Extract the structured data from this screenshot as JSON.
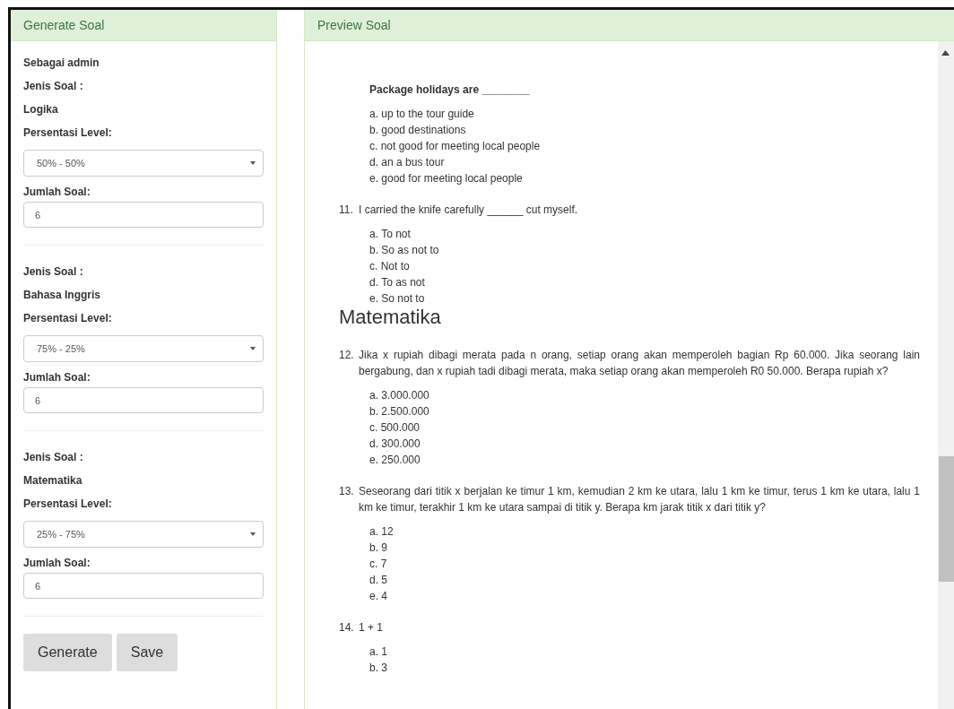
{
  "generate_panel": {
    "title": "Generate Soal",
    "intro": "Sebagai admin",
    "sections": [
      {
        "type_label": "Jenis Soal :",
        "type_value": "Logika",
        "level_label": "Persentasi Level:",
        "level_value": "50% - 50%",
        "count_label": "Jumlah Soal:",
        "count_value": "6"
      },
      {
        "type_label": "Jenis Soal :",
        "type_value": "Bahasa Inggris",
        "level_label": "Persentasi Level:",
        "level_value": "75% - 25%",
        "count_label": "Jumlah Soal:",
        "count_value": "6"
      },
      {
        "type_label": "Jenis Soal :",
        "type_value": "Matematika",
        "level_label": "Persentasi Level:",
        "level_value": "25% - 75%",
        "count_label": "Jumlah Soal:",
        "count_value": "6"
      }
    ],
    "buttons": [
      "Generate",
      "Save"
    ]
  },
  "preview_panel": {
    "title": "Preview Soal",
    "blocks": [
      {
        "kind": "question",
        "bold": true,
        "text": "Package holidays are ________",
        "options": [
          "a. up to the tour guide",
          "b. good destinations",
          "c. not good for meeting local people",
          "d. an a bus tour",
          "e. good for meeting local people"
        ]
      },
      {
        "kind": "question",
        "bold": false,
        "number": "11.",
        "text": "I carried the knife carefully ______ cut myself.",
        "options": [
          "a. To not",
          "b. So as not to",
          "c. Not to",
          "d. To as not",
          "e. So not to"
        ]
      },
      {
        "kind": "heading",
        "text": "Matematika"
      },
      {
        "kind": "question",
        "bold": false,
        "number": "12.",
        "text": "Jika x rupiah dibagi merata pada n orang, setiap orang akan memperoleh bagian Rp 60.000. Jika seorang lain bergabung, dan x rupiah tadi dibagi merata, maka setiap orang akan memperoleh R0 50.000. Berapa rupiah x?",
        "options": [
          "a. 3.000.000",
          "b. 2.500.000",
          "c. 500.000",
          "d. 300.000",
          "e. 250.000"
        ]
      },
      {
        "kind": "question",
        "bold": false,
        "number": "13.",
        "text": "Seseorang dari titik x berjalan ke timur 1 km, kemudian 2 km ke utara, lalu 1 km ke timur, terus 1 km ke utara, lalu 1 km ke timur, terakhir 1 km ke utara sampai di titik y. Berapa km jarak titik x dari titik y?",
        "options": [
          "a. 12",
          "b. 9",
          "c. 7",
          "d. 5",
          "e. 4"
        ]
      },
      {
        "kind": "question",
        "bold": false,
        "number": "14.",
        "text": "1 + 1",
        "options": [
          "a. 1",
          "b. 3"
        ]
      }
    ]
  }
}
